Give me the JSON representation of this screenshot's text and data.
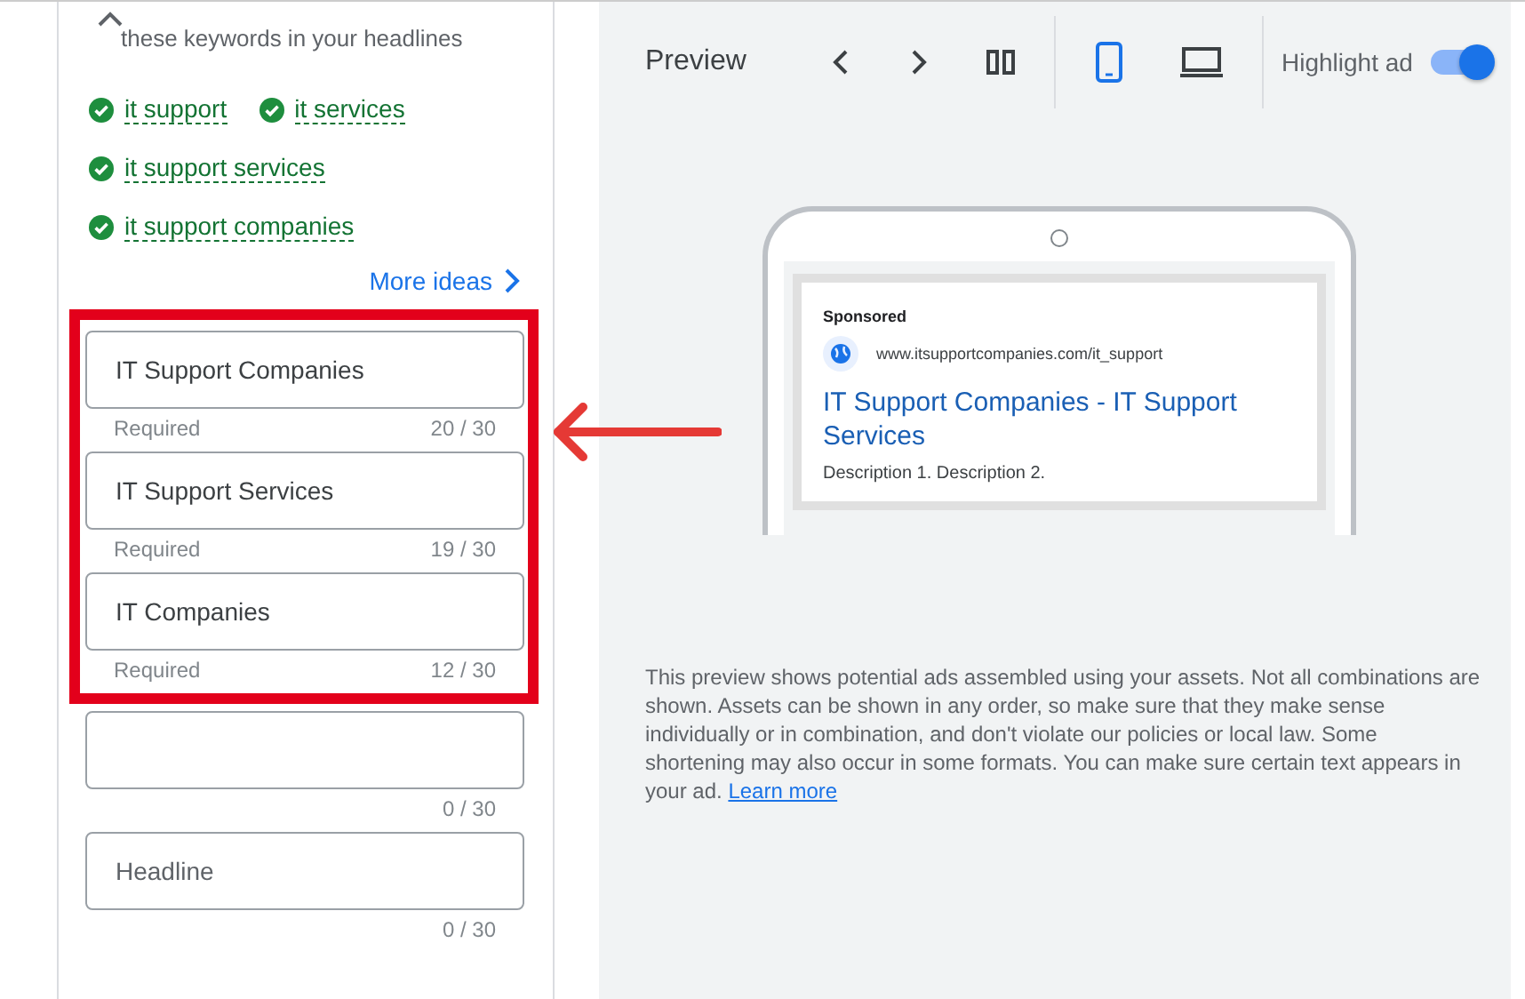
{
  "keywords_panel": {
    "hint": "these keywords in your headlines",
    "expanded": true,
    "keywords": [
      {
        "text": "it support",
        "checked": true
      },
      {
        "text": "it services",
        "checked": true
      },
      {
        "text": "it support services",
        "checked": true
      },
      {
        "text": "it support companies",
        "checked": true
      }
    ],
    "more_ideas": "More ideas"
  },
  "highlight_box": {
    "headlines": [
      {
        "value": "IT Support Companies",
        "helper": "Required",
        "counter": "20 / 30"
      },
      {
        "value": "IT Support Services",
        "helper": "Required",
        "counter": "19 / 30"
      },
      {
        "value": "IT Companies",
        "helper": "Required",
        "counter": "12 / 30"
      }
    ]
  },
  "headlines": [
    {
      "counter": "0 / 30"
    },
    {
      "placeholder": "Headline",
      "counter": "0 / 30"
    }
  ],
  "preview": {
    "title": "Preview",
    "devices": [
      {
        "kind": "mobile",
        "selected": true
      },
      {
        "kind": "desktop",
        "selected": false
      }
    ],
    "highlight_toggle": {
      "label": "Highlight ad",
      "on": true
    },
    "ad": {
      "sponsored": "Sponsored",
      "url": "www.itsupportcompanies.com/it_support",
      "headline": "IT Support Companies - IT Support Services",
      "description": "Description 1. Description 2."
    },
    "disclaimer": "This preview shows potential ads assembled using your assets. Not all combinations are shown. Assets can be shown in any order, so make sure that they make sense individually or in combination, and don't violate our policies or local law. Some shortening may also occur in some formats. You can make sure certain text appears in your ad.",
    "learn_more": "Learn more"
  }
}
